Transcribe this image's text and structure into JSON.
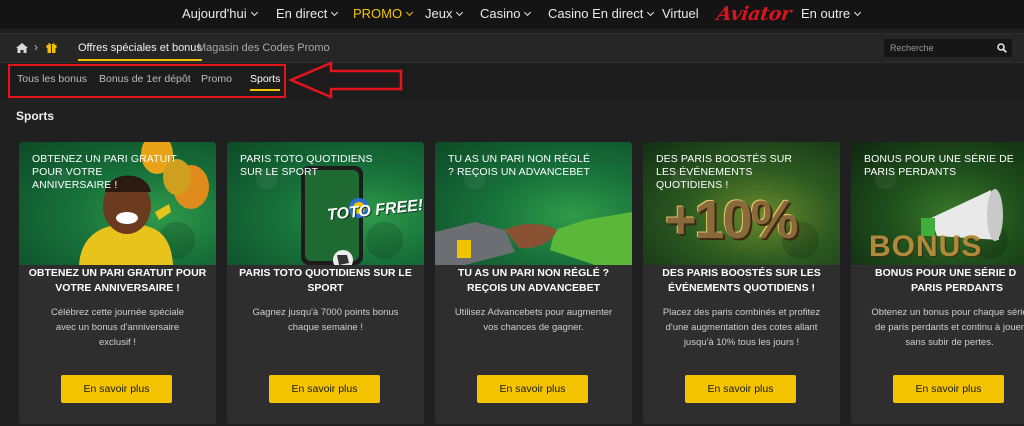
{
  "topnav": {
    "items": [
      {
        "label": "Aujourd'hui",
        "dropdown": true
      },
      {
        "label": "En direct",
        "dropdown": true
      },
      {
        "label": "PROMO",
        "dropdown": true,
        "active": true
      },
      {
        "label": "Jeux",
        "dropdown": true
      },
      {
        "label": "Casino",
        "dropdown": true
      },
      {
        "label": "Casino En direct",
        "dropdown": true
      },
      {
        "label": "Virtuel",
        "dropdown": false
      }
    ],
    "logo": "Aviator",
    "more": {
      "label": "En outre",
      "dropdown": true
    },
    "accent_color": "#f2c200",
    "logo_color": "#d8141c"
  },
  "breadcrumb": {
    "home_icon": "home-icon",
    "separator": "›",
    "gift_icon": "gift-icon",
    "tabs": [
      {
        "label": "Offres spéciales et bonus",
        "active": true
      },
      {
        "label": "Magasin des Codes Promo",
        "active": false
      }
    ],
    "search": {
      "placeholder": "Recherche",
      "value": ""
    }
  },
  "subtabs": [
    {
      "label": "Tous les bonus",
      "active": false
    },
    {
      "label": "Bonus de 1er dépôt",
      "active": false
    },
    {
      "label": "Promo",
      "active": false
    },
    {
      "label": "Sports",
      "active": true
    }
  ],
  "annotation": {
    "box_color": "#e5141b",
    "arrow": "pointing-left"
  },
  "section": {
    "title": "Sports"
  },
  "cards": [
    {
      "banner_text": "OBTENEZ UN PARI GRATUIT POUR VOTRE ANNIVERSAIRE !",
      "title": "OBTENEZ UN PARI GRATUIT POUR VOTRE ANNIVERSAIRE !",
      "description": "Célébrez cette journée spéciale avec un bonus d'anniversaire exclusif !",
      "button": "En savoir plus",
      "art": "birthday-balloons"
    },
    {
      "banner_text": "PARIS TOTO QUOTIDIENS SUR LE SPORT",
      "title": "PARIS TOTO QUOTIDIENS SUR LE SPORT",
      "description": "Gagnez jusqu'à 7000 points bonus chaque semaine !",
      "button": "En savoir plus",
      "art": "toto-free-phone",
      "art_text": "TOTO FREE!"
    },
    {
      "banner_text": "TU AS UN PARI NON RÉGLÉ ? REÇOIS UN ADVANCEBET",
      "title": "TU AS UN PARI NON RÉGLÉ ? REÇOIS UN ADVANCEBET",
      "description": "Utilisez Advancebets pour augmenter vos chances de gagner.",
      "button": "En savoir plus",
      "art": "handshake"
    },
    {
      "banner_text": "DES PARIS BOOSTÉS SUR LES ÉVÉNEMENTS QUOTIDIENS !",
      "title": "DES PARIS BOOSTÉS SUR LES ÉVÉNEMENTS QUOTIDIENS !",
      "description": "Placez des paris combinés et profitez d'une augmentation des cotes allant jusqu'à 10% tous les jours !",
      "button": "En savoir plus",
      "art": "plus-ten-percent",
      "art_text": "+10%"
    },
    {
      "banner_text": "BONUS POUR UNE SÉRIE DE PARIS PERDANTS",
      "title": "BONUS POUR UNE SÉRIE D",
      "title_line2": "PARIS PERDANTS",
      "description": "Obtenez un bonus pour chaque série de paris perdants et continu à jouer sans subir de pertes.",
      "button": "En savoir plus",
      "art": "megaphone",
      "art_text": "BONUS"
    }
  ],
  "button_color": "#f5c400"
}
